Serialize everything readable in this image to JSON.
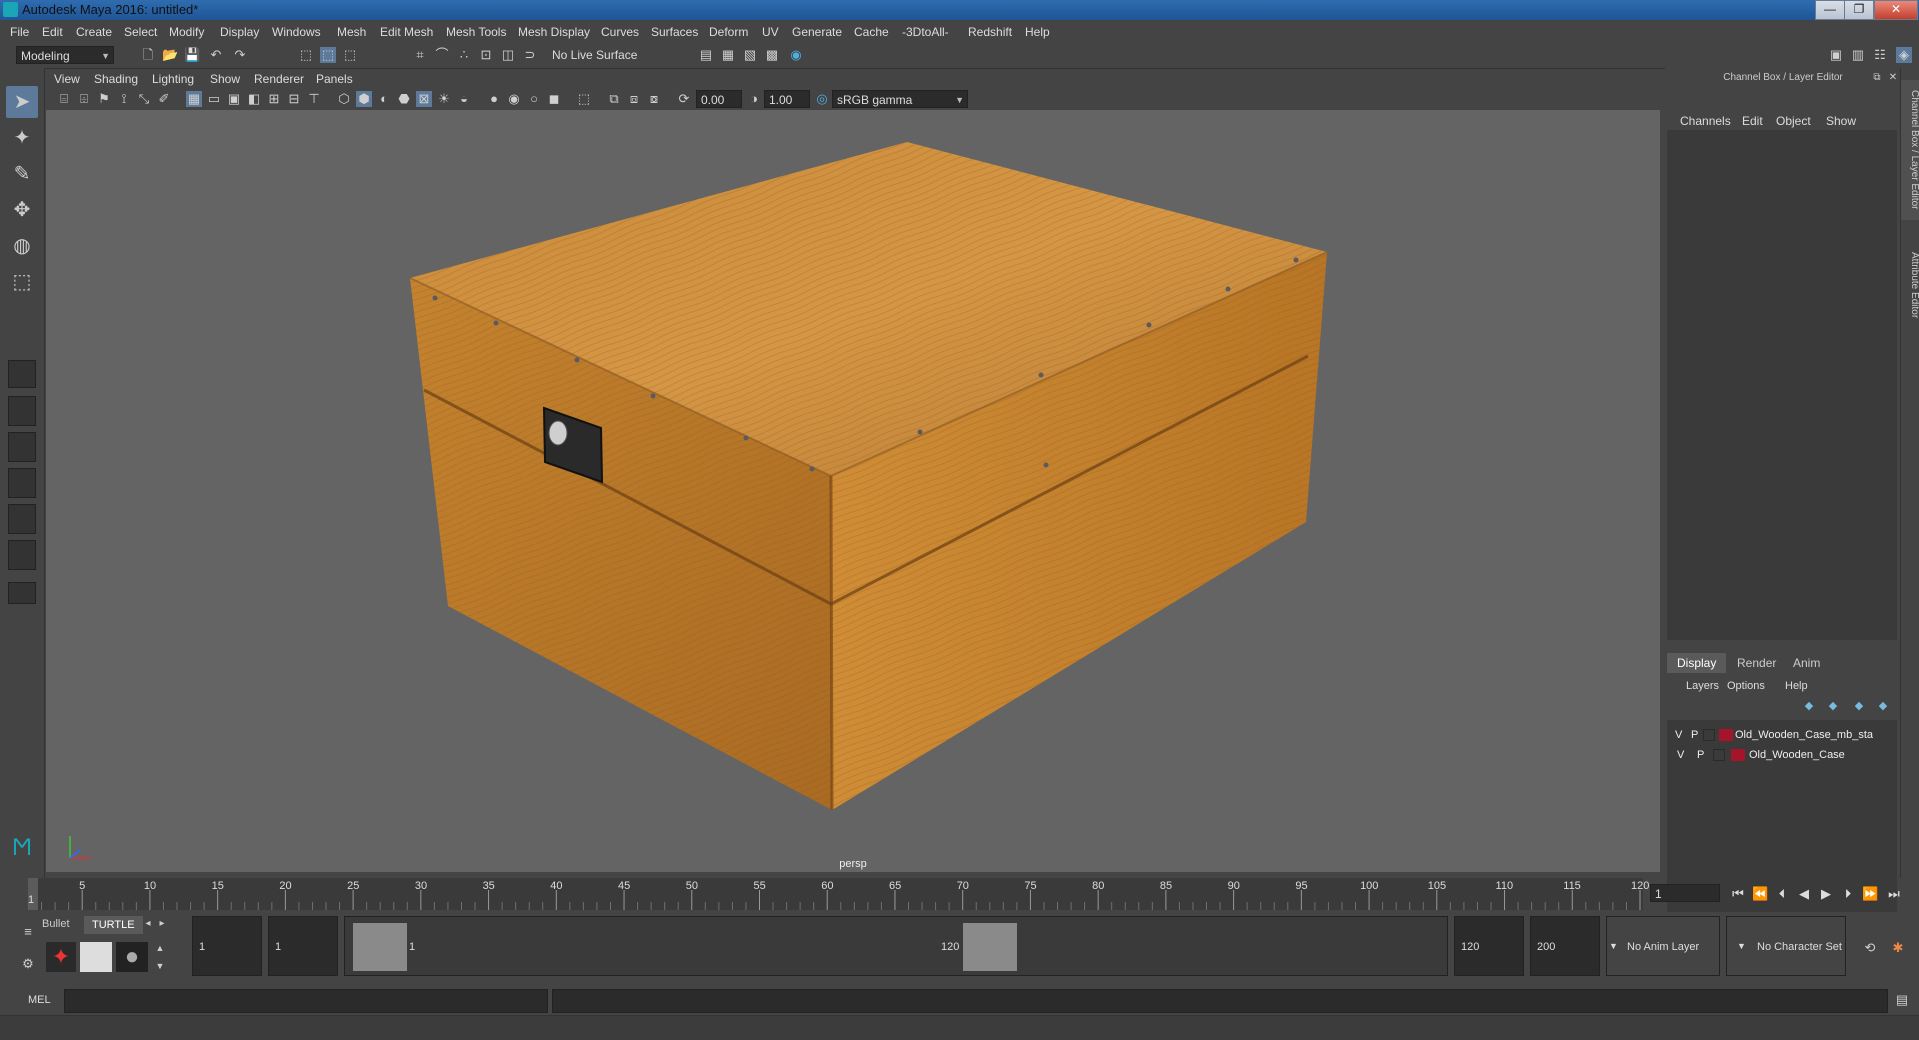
{
  "window": {
    "title": "Autodesk Maya 2016: untitled*",
    "min": "—",
    "max": "❐",
    "close": "✕"
  },
  "menubar": [
    "File",
    "Edit",
    "Create",
    "Select",
    "Modify",
    "Display",
    "Windows",
    "Mesh",
    "Edit Mesh",
    "Mesh Tools",
    "Mesh Display",
    "Curves",
    "Surfaces",
    "Deform",
    "UV",
    "Generate",
    "Cache",
    "-3DtoAll-",
    "Redshift",
    "Help"
  ],
  "statusline": {
    "mode": "Modeling",
    "live_surface": "No Live Surface"
  },
  "viewport": {
    "menu": [
      "View",
      "Shading",
      "Lighting",
      "Show",
      "Renderer",
      "Panels"
    ],
    "exposure": "0.00",
    "gamma": "1.00",
    "color_space": "sRGB gamma",
    "camera": "persp"
  },
  "channel_box": {
    "header": "Channel Box / Layer Editor",
    "menu": [
      "Channels",
      "Edit",
      "Object",
      "Show"
    ]
  },
  "side_tabs": [
    "Channel Box / Layer Editor",
    "Attribute Editor"
  ],
  "layer_editor": {
    "tabs": [
      "Display",
      "Render",
      "Anim"
    ],
    "menu": [
      "Layers",
      "Options",
      "Help"
    ],
    "layers": [
      {
        "v": "V",
        "p": "P",
        "name": "Old_Wooden_Case_mb_sta",
        "color": "#a5142b"
      },
      {
        "v": "V",
        "p": "P",
        "name": "Old_Wooden_Case",
        "color": "#a5142b"
      }
    ]
  },
  "time_slider": {
    "labels": [
      "5",
      "10",
      "15",
      "20",
      "25",
      "30",
      "35",
      "40",
      "45",
      "50",
      "55",
      "60",
      "65",
      "70",
      "75",
      "80",
      "85",
      "90",
      "95",
      "100",
      "105",
      "110",
      "115",
      "120"
    ],
    "start_label": "1",
    "current_frame": "1"
  },
  "range": {
    "start": "1",
    "playback_start": "1",
    "range_start_label": "1",
    "range_end_label": "120",
    "playback_end": "120",
    "end": "200",
    "anim_layer": "No Anim Layer",
    "character_set": "No Character Set"
  },
  "shelf": {
    "tabs": [
      "Bullet",
      "TURTLE"
    ]
  },
  "command_line": {
    "label": "MEL"
  }
}
